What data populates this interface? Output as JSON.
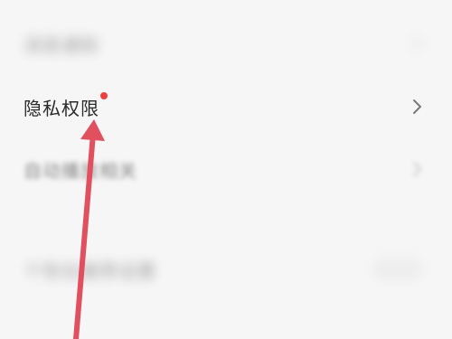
{
  "settings": {
    "row1_label": "消息通知",
    "row2_label": "隐私权限",
    "row3_label": "自动播放相关",
    "row4_label": "个性化推荐设置"
  },
  "colors": {
    "badge_dot": "#ee3e3e",
    "annotation_arrow": "#e0505e"
  },
  "icons": {
    "chevron": "chevron-right-icon"
  }
}
